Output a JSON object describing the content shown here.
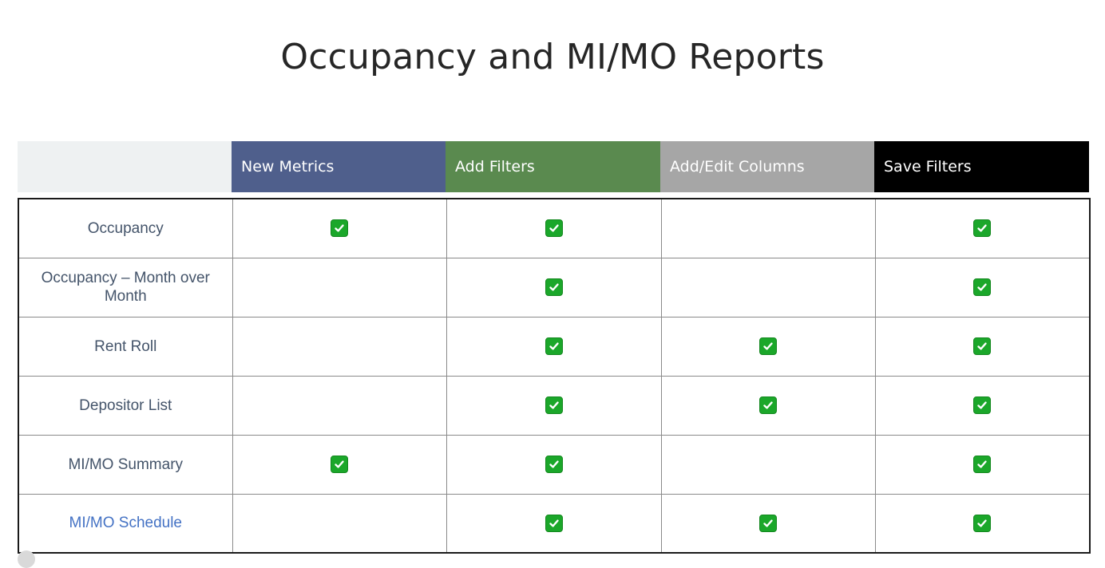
{
  "title": "Occupancy and MI/MO Reports",
  "colors": {
    "new_metrics": "#4f5f8c",
    "add_filters": "#5a8a4f",
    "add_edit_columns": "#a6a6a6",
    "save_filters": "#000000",
    "check": "#1ba72a"
  },
  "columns": [
    {
      "label": "New Metrics",
      "color_key": "new_metrics"
    },
    {
      "label": "Add Filters",
      "color_key": "add_filters"
    },
    {
      "label": "Add/Edit Columns",
      "color_key": "add_edit_columns"
    },
    {
      "label": "Save Filters",
      "color_key": "save_filters"
    }
  ],
  "rows": [
    {
      "label": "Occupancy",
      "checks": [
        true,
        true,
        false,
        true
      ]
    },
    {
      "label": "Occupancy – Month over Month",
      "checks": [
        false,
        true,
        false,
        true
      ]
    },
    {
      "label": "Rent Roll",
      "checks": [
        false,
        true,
        true,
        true
      ]
    },
    {
      "label": "Depositor List",
      "checks": [
        false,
        true,
        true,
        true
      ]
    },
    {
      "label": "MI/MO Summary",
      "checks": [
        true,
        true,
        false,
        true
      ]
    },
    {
      "label": "MI/MO Schedule",
      "checks": [
        false,
        true,
        true,
        true
      ],
      "link": true
    }
  ],
  "check_icon": "checkmark-box-icon"
}
